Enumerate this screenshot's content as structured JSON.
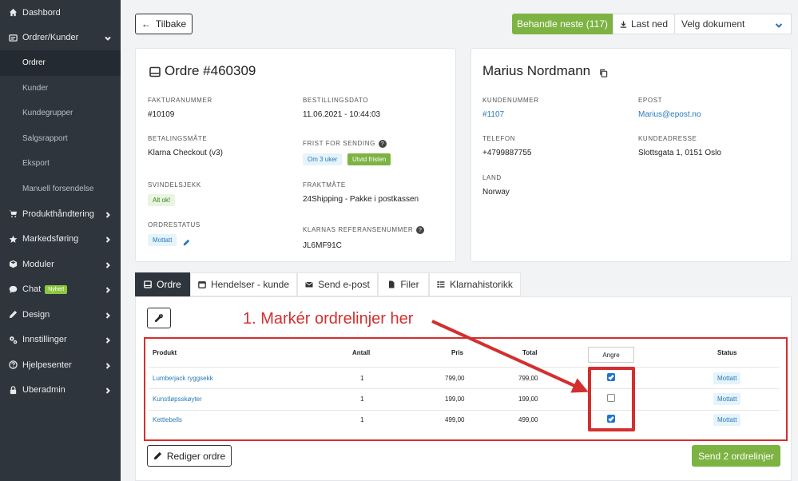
{
  "sidebar": {
    "items": [
      {
        "label": "Dashbord",
        "icon": "home-icon"
      },
      {
        "label": "Ordrer/Kunder",
        "icon": "orders-icon",
        "expanded": true,
        "children": [
          "Ordrer",
          "Kunder",
          "Kundegrupper",
          "Salgsrapport",
          "Eksport",
          "Manuell forsendelse"
        ]
      },
      {
        "label": "Produkthåndtering",
        "icon": "cart-icon"
      },
      {
        "label": "Markedsføring",
        "icon": "star-icon"
      },
      {
        "label": "Moduler",
        "icon": "cube-icon"
      },
      {
        "label": "Chat",
        "icon": "chat-icon",
        "badge": "Nyhet!"
      },
      {
        "label": "Design",
        "icon": "pencil-icon"
      },
      {
        "label": "Innstillinger",
        "icon": "gears-icon"
      },
      {
        "label": "Hjelpesenter",
        "icon": "help-icon"
      },
      {
        "label": "Uberadmin",
        "icon": "lock-icon"
      }
    ]
  },
  "toolbar": {
    "back_label": "Tilbake",
    "next_label": "Behandle neste (117)",
    "load_label": "Last ned",
    "document_select": "Velg dokument"
  },
  "order": {
    "title": "Ordre #460309",
    "invoice_label": "FAKTURANUMMER",
    "invoice_value": "#10109",
    "date_label": "BESTILLINGSDATO",
    "date_value": "11.06.2021 - 10:44:03",
    "payment_label": "BETALINGSMÅTE",
    "payment_value": "Klarna Checkout (v3)",
    "deadline_label": "FRIST FOR SENDING",
    "deadline_value": "Om 3 uker",
    "extend_label": "Utvid fristen",
    "fraud_label": "SVINDELSJEKK",
    "fraud_value": "Alt ok!",
    "shipping_label": "FRAKTMÅTE",
    "shipping_value": "24Shipping - Pakke i postkassen",
    "status_label": "ORDRESTATUS",
    "status_value": "Mottatt",
    "klarna_ref_label": "KLARNAS REFERANSENUMMER",
    "klarna_ref_value": "JL6MF91C"
  },
  "customer": {
    "name": "Marius Nordmann",
    "number_label": "KUNDENUMMER",
    "number_value": "#1107",
    "email_label": "EPOST",
    "email_value": "Marius@epost.no",
    "phone_label": "TELEFON",
    "phone_value": "+4799887755",
    "address_label": "KUNDEADRESSE",
    "address_value": "Slottsgata 1, 0151 Oslo",
    "country_label": "LAND",
    "country_value": "Norway"
  },
  "tabs": [
    {
      "label": "Ordre",
      "active": true
    },
    {
      "label": "Hendelser - kunde",
      "active": false
    },
    {
      "label": "Send e-post",
      "active": false
    },
    {
      "label": "Filer",
      "active": false
    },
    {
      "label": "Klarnahistorikk",
      "active": false
    }
  ],
  "annotation": "1. Markér ordrelinjer her",
  "table": {
    "headers": {
      "product": "Produkt",
      "qty": "Antall",
      "price": "Pris",
      "total": "Total",
      "undo": "Angre",
      "status": "Status"
    },
    "rows": [
      {
        "product": "Lumberjack ryggsekk",
        "qty": "1",
        "price": "799,00",
        "total": "799,00",
        "checked": true,
        "status": "Mottatt"
      },
      {
        "product": "Kunstløpsskøyter",
        "qty": "1",
        "price": "199,00",
        "total": "199,00",
        "checked": false,
        "status": "Mottatt"
      },
      {
        "product": "Kettlebells",
        "qty": "1",
        "price": "499,00",
        "total": "499,00",
        "checked": true,
        "status": "Mottatt"
      }
    ]
  },
  "actions": {
    "edit_label": "Rediger ordre",
    "send_label": "Send 2 ordrelinjer"
  },
  "colors": {
    "sidebar_bg": "#2e353d",
    "accent_green": "#7cb342",
    "link_blue": "#2a7ab8",
    "annotation_red": "#d32f2f"
  }
}
